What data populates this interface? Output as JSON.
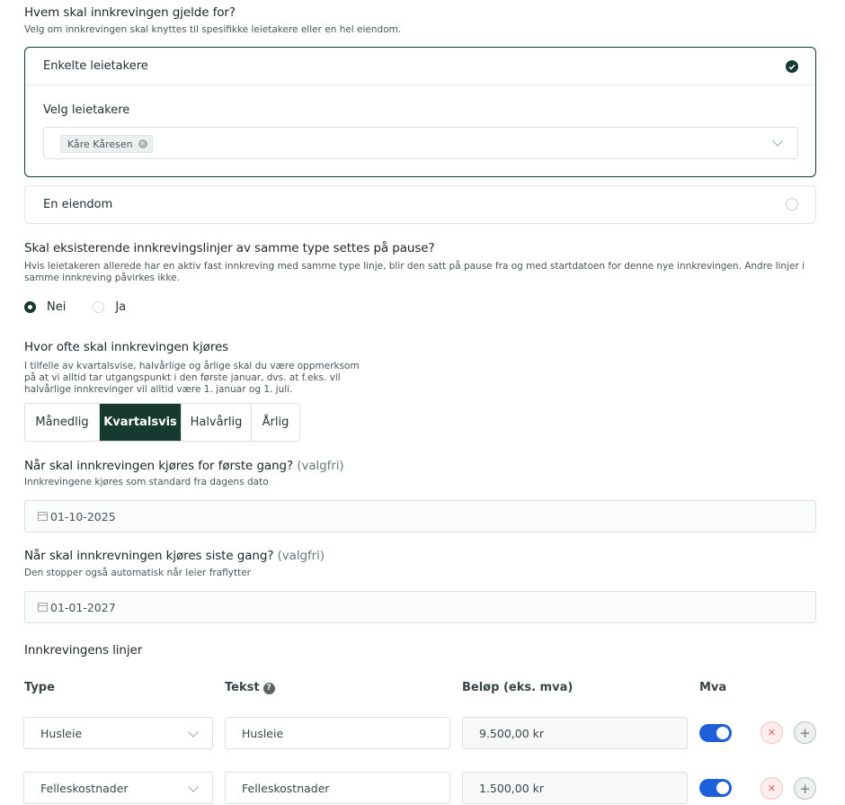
{
  "section_who": {
    "title": "Hvem skal innkrevingen gjelde for?",
    "description": "Velg om innkrevingen skal knyttes til spesifikke leietakere eller en hel eiendom.",
    "option_tenants": "Enkelte leietakere",
    "select_label": "Velg leietakere",
    "selected_tenant": "Kåre Kåresen",
    "option_property": "En eiendom"
  },
  "section_pause": {
    "title": "Skal eksisterende innkrevingslinjer av samme type settes på pause?",
    "description": "Hvis leietakeren allerede har en aktiv fast innkreving med samme type linje, blir den satt på pause fra og med startdatoen for denne nye innkrevingen. Andre linjer i samme innkreving påvirkes ikke.",
    "option_no": "Nei",
    "option_yes": "Ja"
  },
  "section_frequency": {
    "title": "Hvor ofte skal innkrevingen kjøres",
    "description": "I tilfelle av kvartalsvise, halvårlige og årlige skal du være oppmerksom på at vi alltid tar utgangspunkt i den første januar, dvs. at f.eks. vil halvårlige innkrevinger vil alltid være 1. januar og 1. juli.",
    "options": [
      "Månedlig",
      "Kvartalsvis",
      "Halvårlig",
      "Årlig"
    ],
    "selected": "Kvartalsvis"
  },
  "section_first": {
    "title": "Når skal innkrevingen kjøres for første gang?",
    "optional": "(valgfri)",
    "description": "Innkrevingene kjøres som standard fra dagens dato",
    "value": "01-10-2025"
  },
  "section_last": {
    "title": "Når skal innkrevningen kjøres siste gang?",
    "optional": "(valgfri)",
    "description": "Den stopper også automatisk når leier fraflytter",
    "value": "01-01-2027"
  },
  "lines": {
    "title": "Innkrevingens linjer",
    "headers": {
      "type": "Type",
      "text": "Tekst",
      "amount": "Beløp (eks. mva)",
      "vat": "Mva"
    },
    "rows": [
      {
        "type": "Husleie",
        "text": "Husleie",
        "amount": "9.500,00 kr",
        "vat": true
      },
      {
        "type": "Felleskostnader",
        "text": "Felleskostnader",
        "amount": "1.500,00 kr",
        "vat": true
      }
    ]
  },
  "colors": {
    "primary": "#173a30",
    "toggle": "#1c5fd8",
    "delete": "#e06060"
  }
}
